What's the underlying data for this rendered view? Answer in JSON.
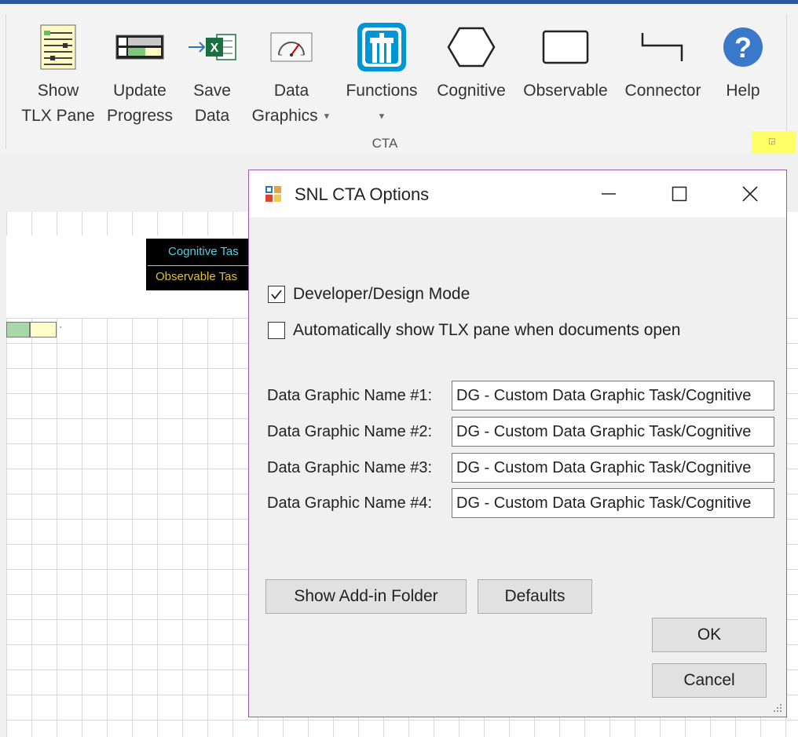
{
  "ribbon": {
    "buttons": {
      "show_tlx": {
        "line1": "Show",
        "line2": "TLX Pane"
      },
      "update_progress": {
        "line1": "Update",
        "line2": "Progress"
      },
      "save_data": {
        "line1": "Save",
        "line2": "Data"
      },
      "data_graphics": {
        "line1": "Data",
        "line2": "Graphics"
      },
      "functions": {
        "line1": "Functions"
      },
      "cognitive": {
        "line1": "Cognitive"
      },
      "observable": {
        "line1": "Observable"
      },
      "connector": {
        "line1": "Connector"
      },
      "help": {
        "line1": "Help"
      }
    },
    "group_label": "CTA",
    "accent_color": "#2b579a"
  },
  "canvas": {
    "legend": {
      "cognitive": "Cognitive Tas",
      "observable": "Observable Tas"
    }
  },
  "dialog": {
    "title": "SNL CTA Options",
    "checkboxes": [
      {
        "label": "Developer/Design Mode",
        "checked": true
      },
      {
        "label": "Automatically show TLX pane when documents open",
        "checked": false
      }
    ],
    "data_graphics": [
      {
        "label": "Data Graphic Name #1:",
        "value": "DG - Custom Data Graphic Task/Cognitive"
      },
      {
        "label": "Data Graphic Name #2:",
        "value": "DG - Custom Data Graphic Task/Cognitive"
      },
      {
        "label": "Data Graphic Name #3:",
        "value": "DG - Custom Data Graphic Task/Cognitive"
      },
      {
        "label": "Data Graphic Name #4:",
        "value": "DG - Custom Data Graphic Task/Cognitive"
      }
    ],
    "buttons": {
      "show_addin_folder": "Show Add-in Folder",
      "defaults": "Defaults",
      "ok": "OK",
      "cancel": "Cancel"
    },
    "border_color": "#9b59b6"
  }
}
